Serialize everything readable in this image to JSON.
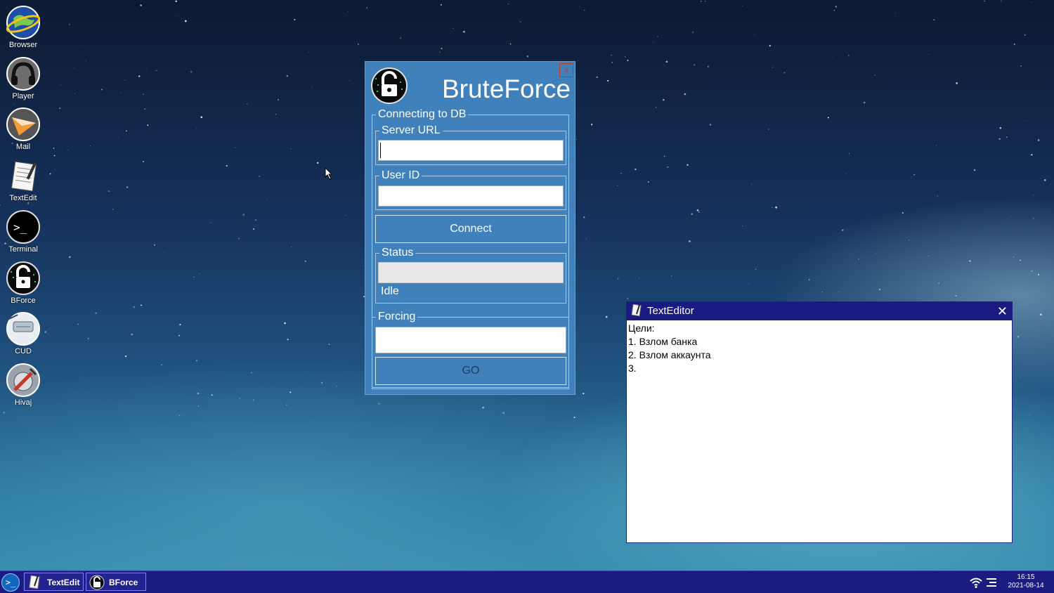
{
  "desktop": {
    "icons": [
      {
        "label": "Browser",
        "icon": "globe-icon"
      },
      {
        "label": "Player",
        "icon": "headphones-icon"
      },
      {
        "label": "Mail",
        "icon": "paper-plane-icon"
      },
      {
        "label": "TextEdit",
        "icon": "notepad-icon"
      },
      {
        "label": "Terminal",
        "icon": "terminal-icon"
      },
      {
        "label": "BForce",
        "icon": "unlock-icon"
      },
      {
        "label": "CUD",
        "icon": "drive-icon"
      },
      {
        "label": "Hivaj",
        "icon": "tools-icon"
      }
    ]
  },
  "bruteforce": {
    "title": "BruteForce",
    "close_label": "x",
    "group_connect": "Connecting to DB",
    "server_url_label": "Server URL",
    "server_url_value": "",
    "user_id_label": "User ID",
    "user_id_value": "",
    "connect_label": "Connect",
    "status_label": "Status",
    "status_text": "Idle",
    "forcing_label": "Forcing",
    "forcing_value": "",
    "go_label": "GO"
  },
  "texteditor": {
    "title": "TextEditor",
    "close_label": "✕",
    "lines": [
      "Цели:",
      "1. Взлом банка",
      "2. Взлом аккаунта",
      "3."
    ]
  },
  "taskbar": {
    "start_label": ">_",
    "tasks": [
      {
        "label": "TextEdit",
        "icon": "notepad-icon"
      },
      {
        "label": "BForce",
        "icon": "unlock-icon"
      }
    ],
    "clock_time": "16:15",
    "clock_date": "2021-08-14"
  },
  "colors": {
    "window_blue": "#4080bb",
    "taskbar": "#1c1c80",
    "titlebar": "#1a1a80",
    "close_red": "#c0392b"
  }
}
